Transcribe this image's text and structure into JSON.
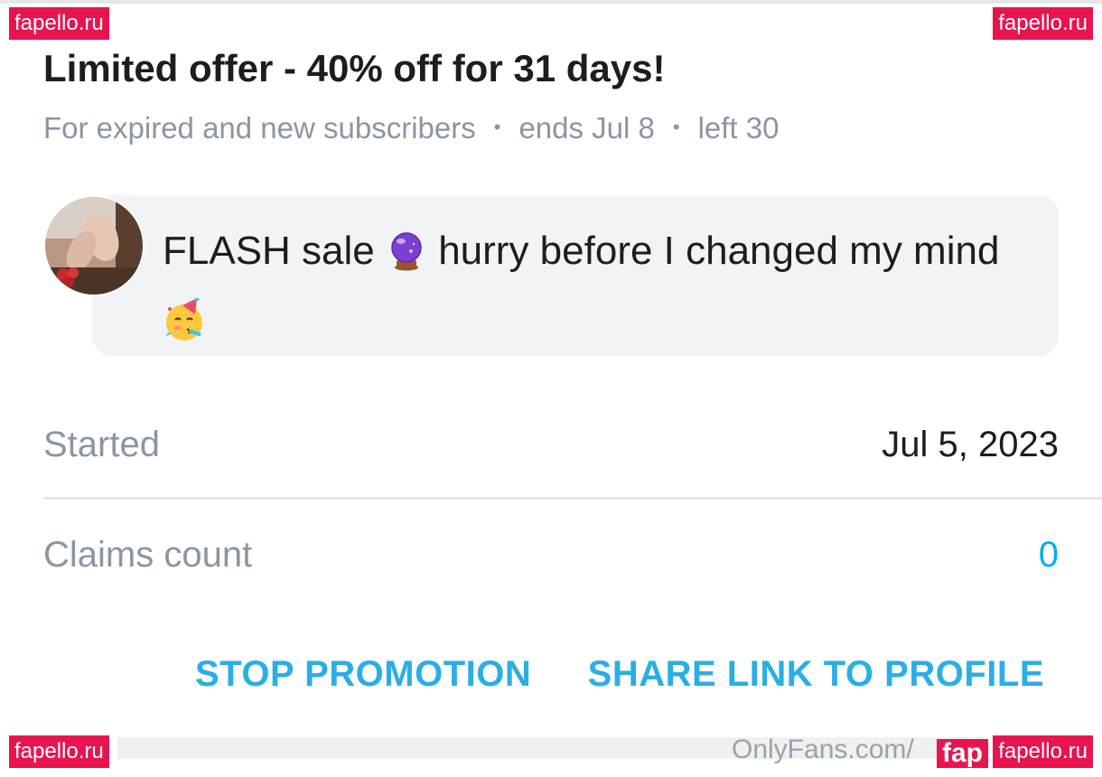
{
  "watermarks": {
    "top_left": "fapello.ru",
    "top_right": "fapello.ru",
    "bottom_left": "fapello.ru",
    "bottom_right": "fapello.ru",
    "bottom_right_partial": "fap"
  },
  "offer": {
    "title": "Limited offer - 40% off for 31 days!",
    "audience": "For expired and new subscribers",
    "ends": "ends Jul 8",
    "left": "left 30",
    "separator": "•"
  },
  "message": {
    "part1": "FLASH sale ",
    "part2": " hurry before I changed my mind ",
    "emoji1": "crystal-ball-icon",
    "emoji2": "partying-face-icon"
  },
  "stats": {
    "started_label": "Started",
    "started_value": "Jul 5, 2023",
    "claims_label": "Claims count",
    "claims_value": "0"
  },
  "actions": {
    "stop_label": "STOP PROMOTION",
    "share_label": "SHARE LINK TO PROFILE"
  },
  "footer": {
    "url": "OnlyFans.com/"
  },
  "colors": {
    "accent": "#00aff0",
    "button": "#2aaee6",
    "muted": "#8a96a3",
    "text": "#1c1d21",
    "watermark": "#e8144f"
  }
}
